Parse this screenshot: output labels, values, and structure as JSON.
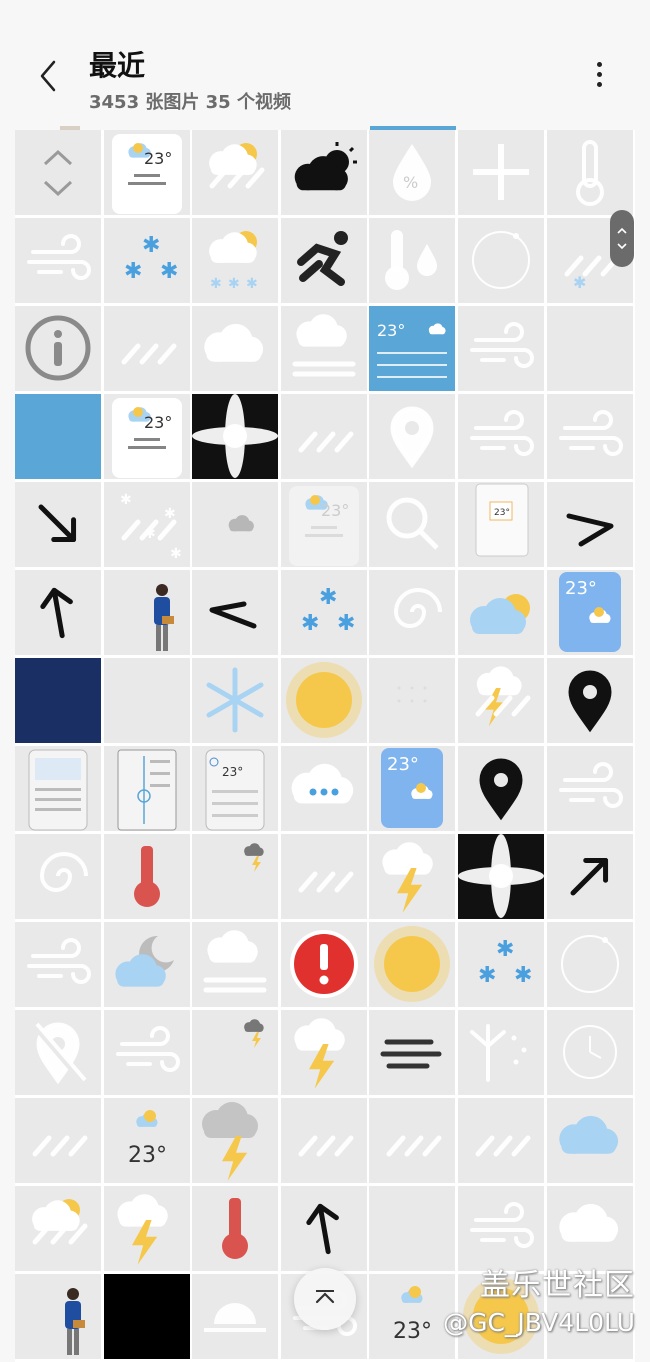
{
  "header": {
    "title": "最近",
    "subtitle": "3453 张图片 35 个视频"
  },
  "colors": {
    "background": "#f7f7f7",
    "tile": "#e9e9e9",
    "accent_blue": "#5aa6d6",
    "sun": "#f5c84c",
    "alert_red": "#e0312f"
  },
  "grid": {
    "columns": 7,
    "rows": [
      [
        "chevron-up-down-icon",
        "weather-widget-small",
        "partly-cloudy-rain-icon",
        "sun-behind-cloud-black-icon",
        "humidity-drop-icon",
        "plus-icon",
        "thermometer-outline-icon"
      ],
      [
        "wind-icon",
        "snow-icon",
        "partly-cloudy-snow-icon",
        "running-person-icon",
        "temperature-drop-icon",
        "loading-circle-icon",
        "sleet-icon"
      ],
      [
        "info-icon",
        "rain-streaks-icon",
        "cloud-icon",
        "fog-cloud-icon",
        "weather-forecast-card",
        "wind-icon",
        "blank-tile"
      ],
      [
        "blue-tile",
        "weather-widget-small",
        "blur-cross-texture",
        "rain-streaks-icon",
        "location-pin-outline-icon",
        "wind-icon",
        "wind-icon"
      ],
      [
        "arrow-down-right-icon",
        "heavy-snow-icon",
        "cloud-small-icon",
        "faded-weather-widget",
        "search-icon",
        "phone-widget-thumbnail",
        "arrow-right-icon"
      ],
      [
        "arrow-up-icon",
        "person-photo",
        "arrow-left-icon",
        "snow-icon",
        "spiral-icon",
        "partly-cloudy-icon",
        "weather-card-blue"
      ],
      [
        "night-sky-photo",
        "blank-tile",
        "snowflake-icon",
        "sun-glow-icon",
        "dotted-grid-icon",
        "thunder-rain-icon",
        "location-pin-icon"
      ],
      [
        "app-screenshot",
        "app-screenshot-slider",
        "app-screenshot-forecast",
        "typing-cloud-icon",
        "weather-card-blue",
        "location-pin-icon",
        "wind-icon"
      ],
      [
        "spiral-icon",
        "thermometer-red-icon",
        "small-thunder-cloud-icon",
        "rain-streaks-icon",
        "thunderstorm-icon",
        "blur-cross-texture",
        "arrow-up-right-icon"
      ],
      [
        "wind-icon",
        "moon-cloud-icon",
        "fog-cloud-icon",
        "alert-icon",
        "sun-glow-icon",
        "snow-icon",
        "loading-circle-icon"
      ],
      [
        "no-location-icon",
        "wind-icon",
        "small-thunder-cloud-icon",
        "thunderstorm-icon",
        "wind-dark-icon",
        "dust-icon",
        "clock-icon"
      ],
      [
        "rain-streaks-icon",
        "temperature-tile",
        "thunder-cloud-icon",
        "rain-streaks-icon",
        "rain-streaks-icon",
        "rain-streaks-icon",
        "cloud-blue-icon"
      ],
      [
        "partly-cloudy-rain-icon",
        "thunderstorm-icon",
        "thermometer-red-icon",
        "arrow-up-icon",
        "blank-tile",
        "wind-icon",
        "cloud-icon"
      ],
      [
        "person-photo",
        "black-tile",
        "sunrise-icon",
        "wind-icon",
        "temperature-tile",
        "sun-glow-icon",
        "blank-tile"
      ]
    ],
    "widget_temp": "23°"
  },
  "scroll": {
    "handle_icon": "scroll-handle-icon",
    "top_button_icon": "scroll-to-top-icon"
  },
  "watermark": {
    "title": "盖乐世社区",
    "handle": "@GC_JBV4L0LU"
  }
}
